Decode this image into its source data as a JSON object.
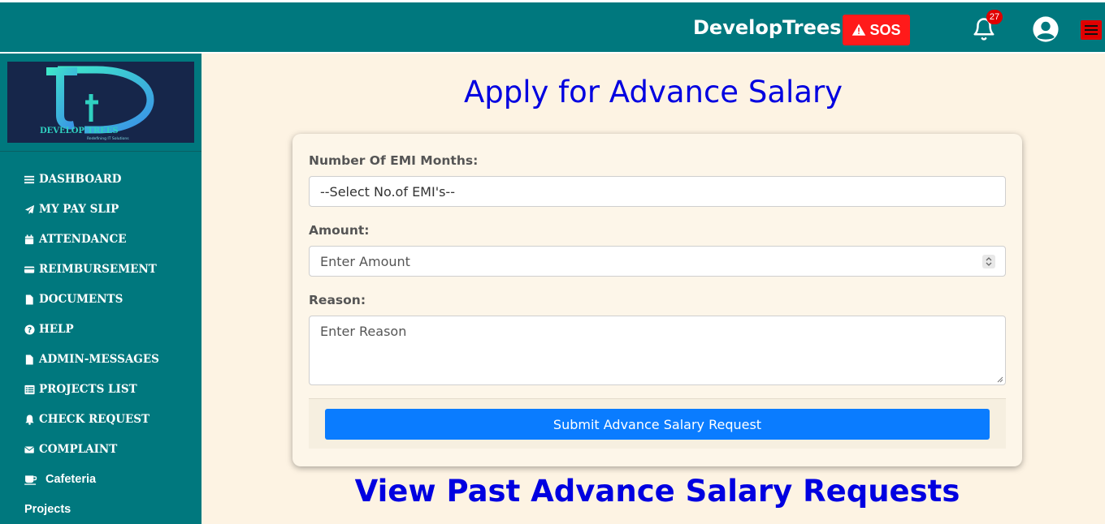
{
  "header": {
    "brand": "DevelopTrees",
    "sos_label": "SOS",
    "notification_count": "27"
  },
  "sidebar": {
    "logo_text": "DEVELOP TREES",
    "logo_tagline": "Redefining IT Solutions",
    "items": [
      {
        "label": "DASHBOARD",
        "icon": "bars-icon"
      },
      {
        "label": "MY PAY SLIP",
        "icon": "paper-plane-icon"
      },
      {
        "label": "ATTENDANCE",
        "icon": "calendar-icon"
      },
      {
        "label": "REIMBURSEMENT",
        "icon": "credit-card-icon"
      },
      {
        "label": "DOCUMENTS",
        "icon": "file-icon"
      },
      {
        "label": "HELP",
        "icon": "question-circle-icon"
      },
      {
        "label": "ADMIN-MESSAGES",
        "icon": "file-icon"
      },
      {
        "label": "PROJECTS LIST",
        "icon": "list-icon"
      },
      {
        "label": "CHECK REQUEST",
        "icon": "bell-icon"
      },
      {
        "label": "COMPLAINT",
        "icon": "envelope-icon"
      },
      {
        "label": "Cafeteria",
        "icon": "coffee-icon"
      },
      {
        "label": "Projects",
        "icon": ""
      }
    ]
  },
  "main": {
    "title": "Apply for Advance Salary",
    "form": {
      "emi_label": "Number Of EMI Months:",
      "emi_selected": "--Select No.of EMI's--",
      "amount_label": "Amount:",
      "amount_placeholder": "Enter Amount",
      "reason_label": "Reason:",
      "reason_placeholder": "Enter Reason",
      "submit_label": "Submit Advance Salary Request"
    },
    "past_title": "View Past Advance Salary Requests"
  },
  "colors": {
    "header_bg": "#00787e",
    "sidebar_bg": "#00787e",
    "page_bg": "#fdf3e3",
    "title_color": "#0000e0",
    "sos_bg": "#ff1a1a",
    "submit_bg": "#0a7cff"
  }
}
